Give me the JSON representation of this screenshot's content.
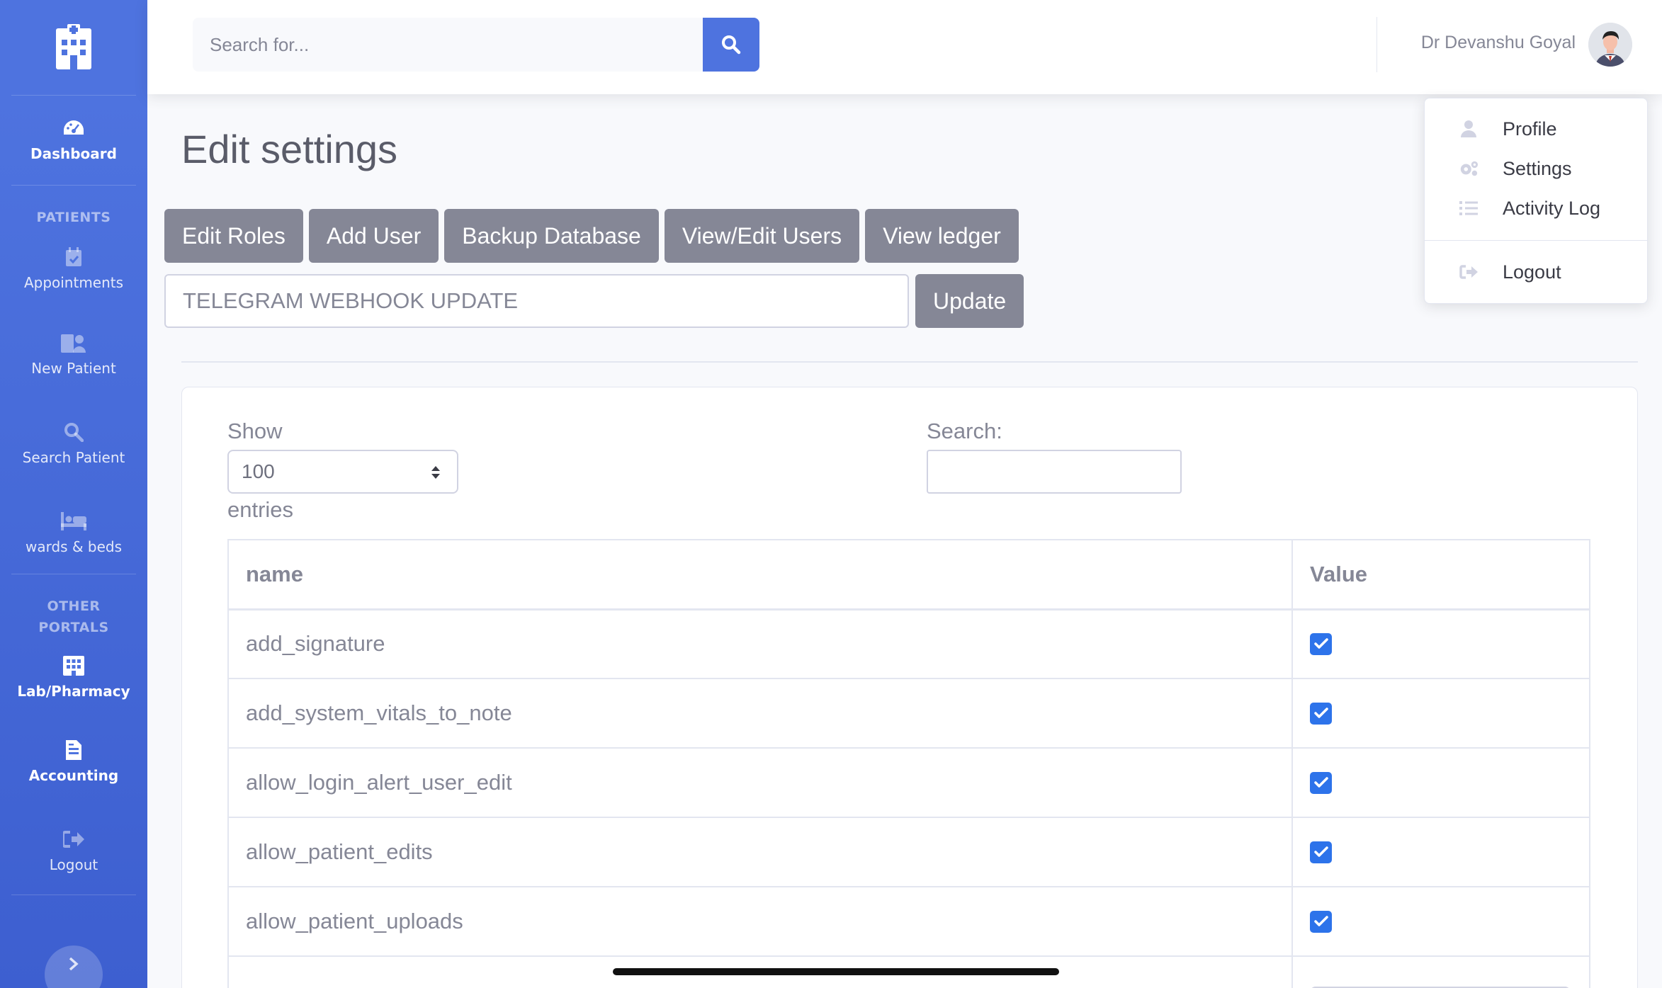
{
  "sidebar": {
    "section_patients": "PATIENTS",
    "section_other": "OTHER PORTALS",
    "items": [
      {
        "label": "Dashboard",
        "icon": "tachometer-icon"
      },
      {
        "label": "Appointments",
        "icon": "calendar-check-icon"
      },
      {
        "label": "New Patient",
        "icon": "hospital-user-icon"
      },
      {
        "label": "Search Patient",
        "icon": "search-icon"
      },
      {
        "label": "wards & beds",
        "icon": "bed-icon"
      },
      {
        "label": "Lab/Pharmacy",
        "icon": "building-icon"
      },
      {
        "label": "Accounting",
        "icon": "file-invoice-icon"
      },
      {
        "label": "Logout",
        "icon": "sign-out-icon"
      }
    ]
  },
  "topbar": {
    "search_placeholder": "Search for...",
    "user_name": "Dr Devanshu Goyal"
  },
  "user_menu": {
    "items": [
      {
        "label": "Profile",
        "icon": "user-icon"
      },
      {
        "label": "Settings",
        "icon": "cogs-icon"
      },
      {
        "label": "Activity Log",
        "icon": "list-icon"
      },
      {
        "label": "Logout",
        "icon": "sign-out-icon"
      }
    ]
  },
  "page": {
    "title": "Edit settings",
    "buttons": [
      "Edit Roles",
      "Add User",
      "Backup Database",
      "View/Edit Users",
      "View ledger"
    ],
    "webhook_placeholder": "TELEGRAM WEBHOOK UPDATE",
    "update_label": "Update"
  },
  "table": {
    "show_label": "Show",
    "entries_value": "100",
    "entries_label": "entries",
    "search_label": "Search:",
    "columns": [
      "name",
      "Value"
    ],
    "rows": [
      {
        "name": "add_signature",
        "checked": true
      },
      {
        "name": "add_system_vitals_to_note",
        "checked": true
      },
      {
        "name": "allow_login_alert_user_edit",
        "checked": true
      },
      {
        "name": "allow_patient_edits",
        "checked": true
      },
      {
        "name": "allow_patient_uploads",
        "checked": true
      }
    ]
  },
  "colors": {
    "primary": "#4e73df",
    "secondary": "#858796",
    "checkbox": "#2d73ea"
  }
}
